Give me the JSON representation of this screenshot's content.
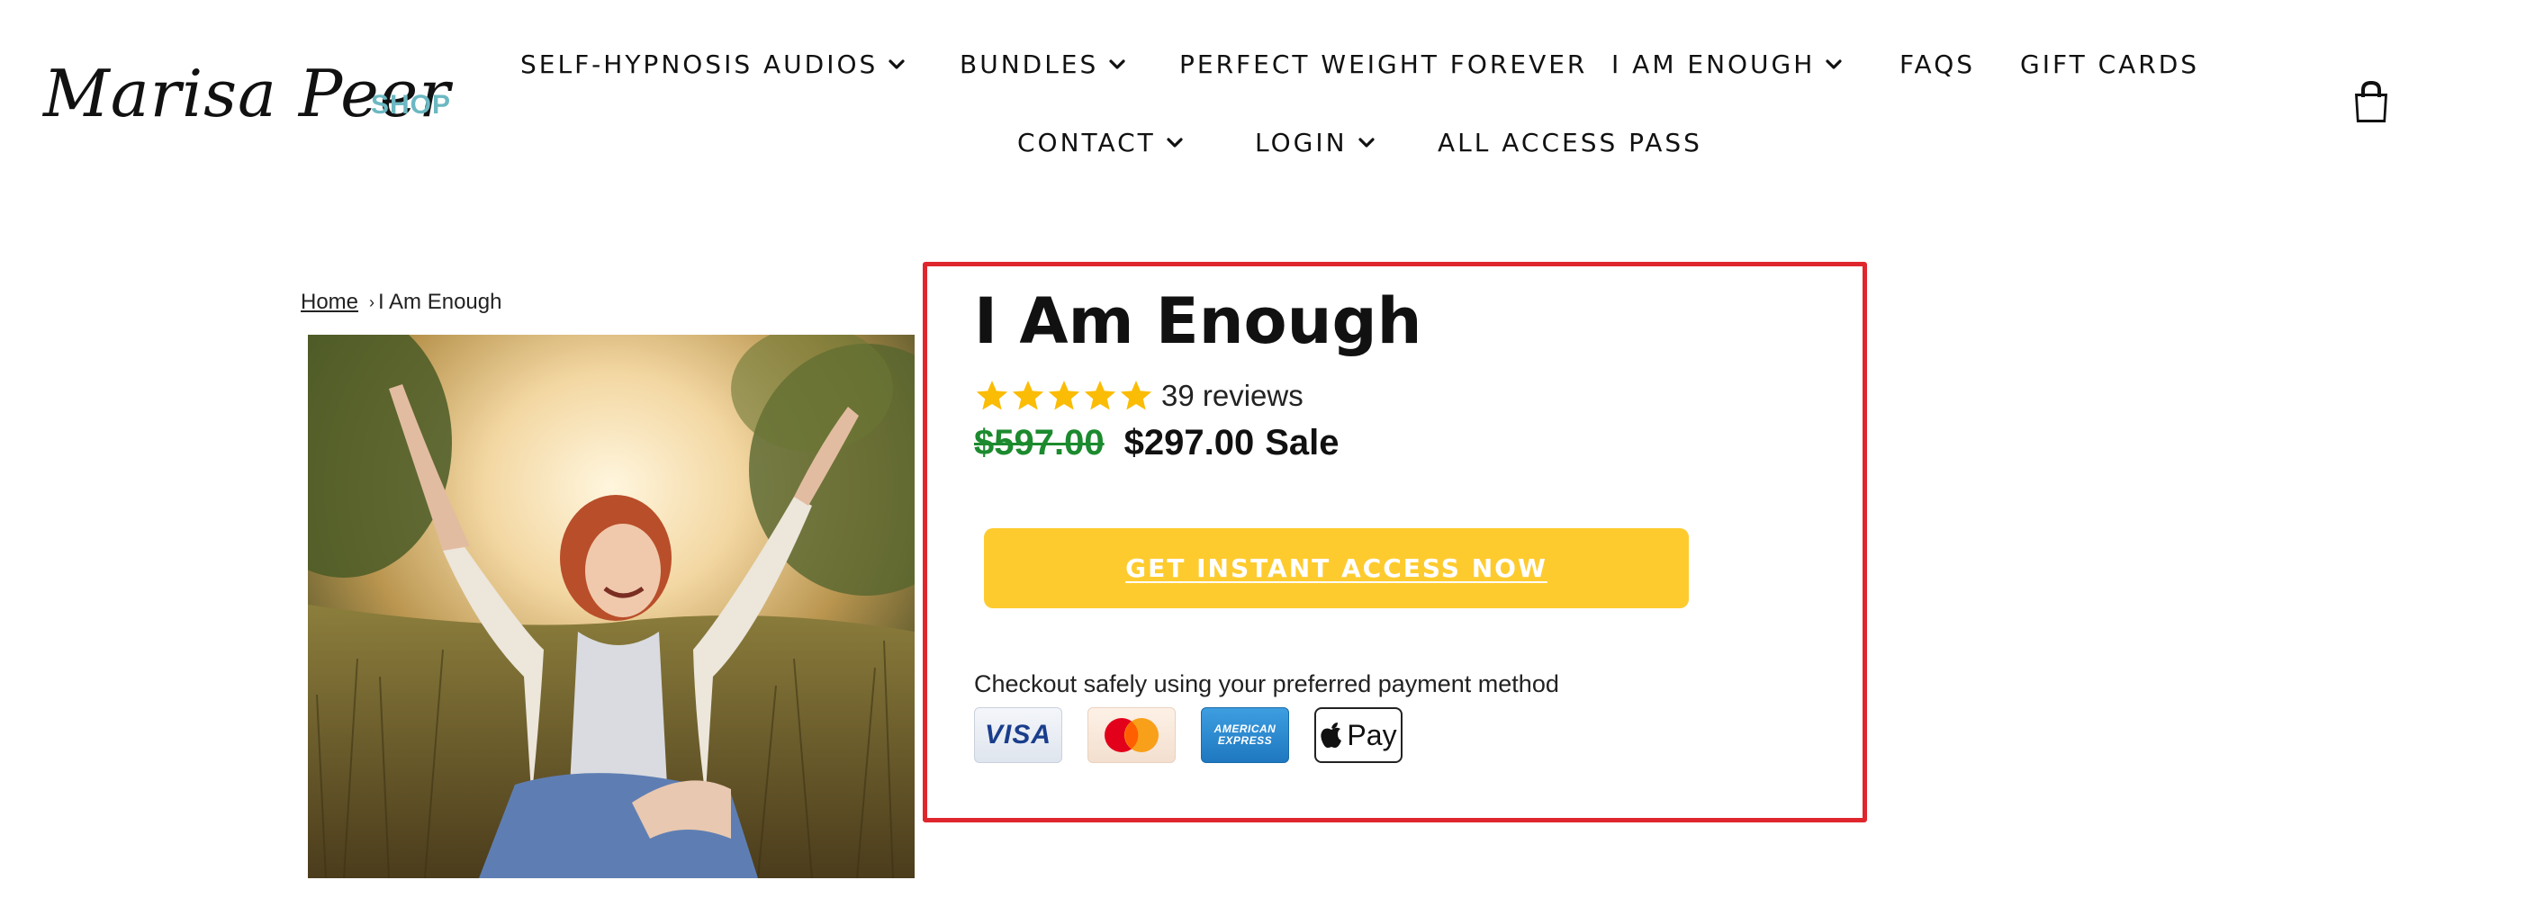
{
  "logo": {
    "script": "Marisa Peer",
    "suffix": "SHOP"
  },
  "nav": {
    "row1": [
      {
        "label": "SELF-HYPNOSIS AUDIOS",
        "dropdown": true
      },
      {
        "label": "BUNDLES",
        "dropdown": true
      },
      {
        "label": "PERFECT WEIGHT FOREVER",
        "dropdown": false
      },
      {
        "label": "I AM ENOUGH",
        "dropdown": true
      },
      {
        "label": "FAQS",
        "dropdown": false
      },
      {
        "label": "GIFT CARDS",
        "dropdown": false
      }
    ],
    "row2": [
      {
        "label": "CONTACT",
        "dropdown": true
      },
      {
        "label": "LOGIN",
        "dropdown": true
      },
      {
        "label": "ALL ACCESS PASS",
        "dropdown": false
      }
    ]
  },
  "icons": {
    "cart": "shopping-bag-icon",
    "dropdown": "chevron-down-icon",
    "star": "star-icon",
    "breadcrumb_separator": "chevron-right-icon"
  },
  "breadcrumb": {
    "home": "Home",
    "separator": "›",
    "current": "I Am Enough"
  },
  "product": {
    "title": "I Am Enough",
    "rating_stars": 5,
    "reviews_label": "39 reviews",
    "price_original": "$597.00",
    "price_current": "$297.00",
    "sale_label": "Sale",
    "cta_label": "GET INSTANT ACCESS NOW",
    "checkout_text": "Checkout safely using your preferred payment method",
    "payment_methods": {
      "visa": "VISA",
      "mastercard": "MasterCard",
      "amex": "AMERICAN EXPRESS",
      "apple_pay": "Pay"
    }
  },
  "colors": {
    "cta_background": "#fecb2f",
    "highlight_border": "#e0262d",
    "old_price": "#1c8a2e",
    "shop_accent": "#6cb8c2",
    "star": "#fbbc05"
  }
}
